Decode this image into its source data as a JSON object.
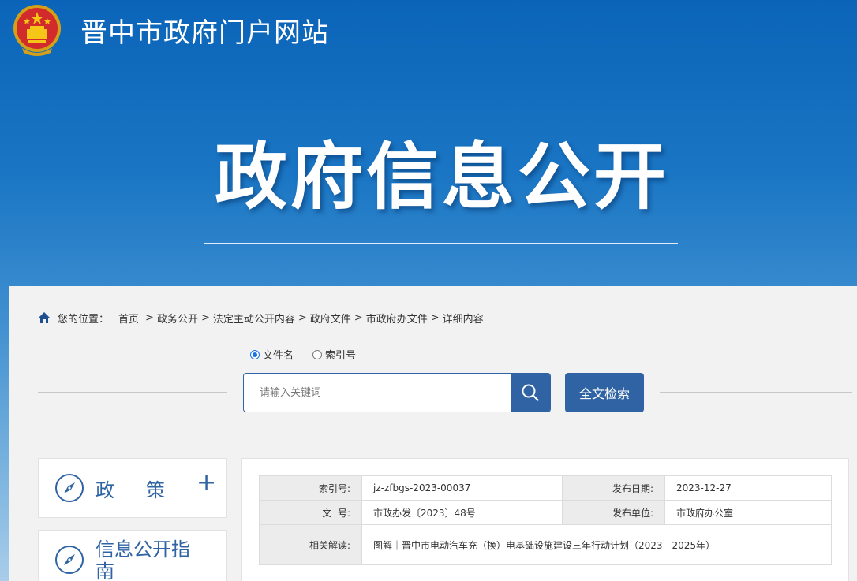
{
  "header": {
    "site_title": "晋中市政府门户网站",
    "hero_title": "政府信息公开"
  },
  "breadcrumb": {
    "prefix": "您的位置：",
    "items": [
      "首页",
      "政务公开",
      "法定主动公开内容",
      "政府文件",
      "市政府办文件",
      "详细内容"
    ],
    "separator": ">"
  },
  "search": {
    "radio_options": [
      {
        "label": "文件名",
        "checked": true
      },
      {
        "label": "索引号",
        "checked": false
      }
    ],
    "placeholder": "请输入关键词",
    "fulltext_label": "全文检索"
  },
  "sidebar": {
    "items": [
      {
        "label": "政策",
        "icon": "compass-icon",
        "expand": "+"
      },
      {
        "label": "信息公开指南",
        "icon": "compass-icon"
      }
    ]
  },
  "meta": {
    "index_label": "索引号:",
    "index_value": "jz-zfbgs-2023-00037",
    "date_label": "发布日期:",
    "date_value": "2023-12-27",
    "docno_label": "文  号:",
    "docno_value": "市政办发〔2023〕48号",
    "unit_label": "发布单位:",
    "unit_value": "市政府办公室",
    "related_label": "相关解读:",
    "related_value": "图解｜晋中市电动汽车充（换）电基础设施建设三年行动计划（2023—2025年）"
  },
  "colors": {
    "primary": "#2f63a3",
    "header_blue": "#0b64b8",
    "panel_bg": "#f2f2f2"
  }
}
